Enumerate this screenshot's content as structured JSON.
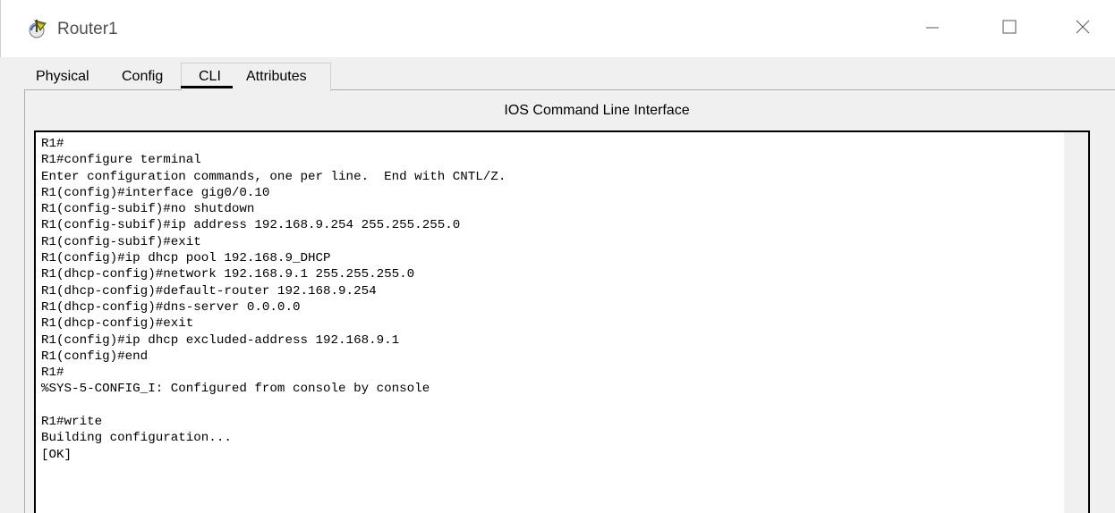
{
  "window": {
    "title": "Router1",
    "icon": "router-app-icon",
    "controls": {
      "minimize": "minimize-icon",
      "maximize": "maximize-icon",
      "close": "close-icon"
    }
  },
  "tabs": [
    {
      "label": "Physical",
      "selected": false
    },
    {
      "label": "Config",
      "selected": false
    },
    {
      "label": "CLI",
      "selected": true
    },
    {
      "label": "Attributes",
      "selected": false
    }
  ],
  "cli": {
    "header": "IOS Command Line Interface",
    "lines": [
      "R1#",
      "R1#configure terminal",
      "Enter configuration commands, one per line.  End with CNTL/Z.",
      "R1(config)#interface gig0/0.10",
      "R1(config-subif)#no shutdown",
      "R1(config-subif)#ip address 192.168.9.254 255.255.255.0",
      "R1(config-subif)#exit",
      "R1(config)#ip dhcp pool 192.168.9_DHCP",
      "R1(dhcp-config)#network 192.168.9.1 255.255.255.0",
      "R1(dhcp-config)#default-router 192.168.9.254",
      "R1(dhcp-config)#dns-server 0.0.0.0",
      "R1(dhcp-config)#exit",
      "R1(config)#ip dhcp excluded-address 192.168.9.1",
      "R1(config)#end",
      "R1#",
      "%SYS-5-CONFIG_I: Configured from console by console",
      "",
      "R1#write",
      "Building configuration...",
      "[OK]"
    ]
  }
}
